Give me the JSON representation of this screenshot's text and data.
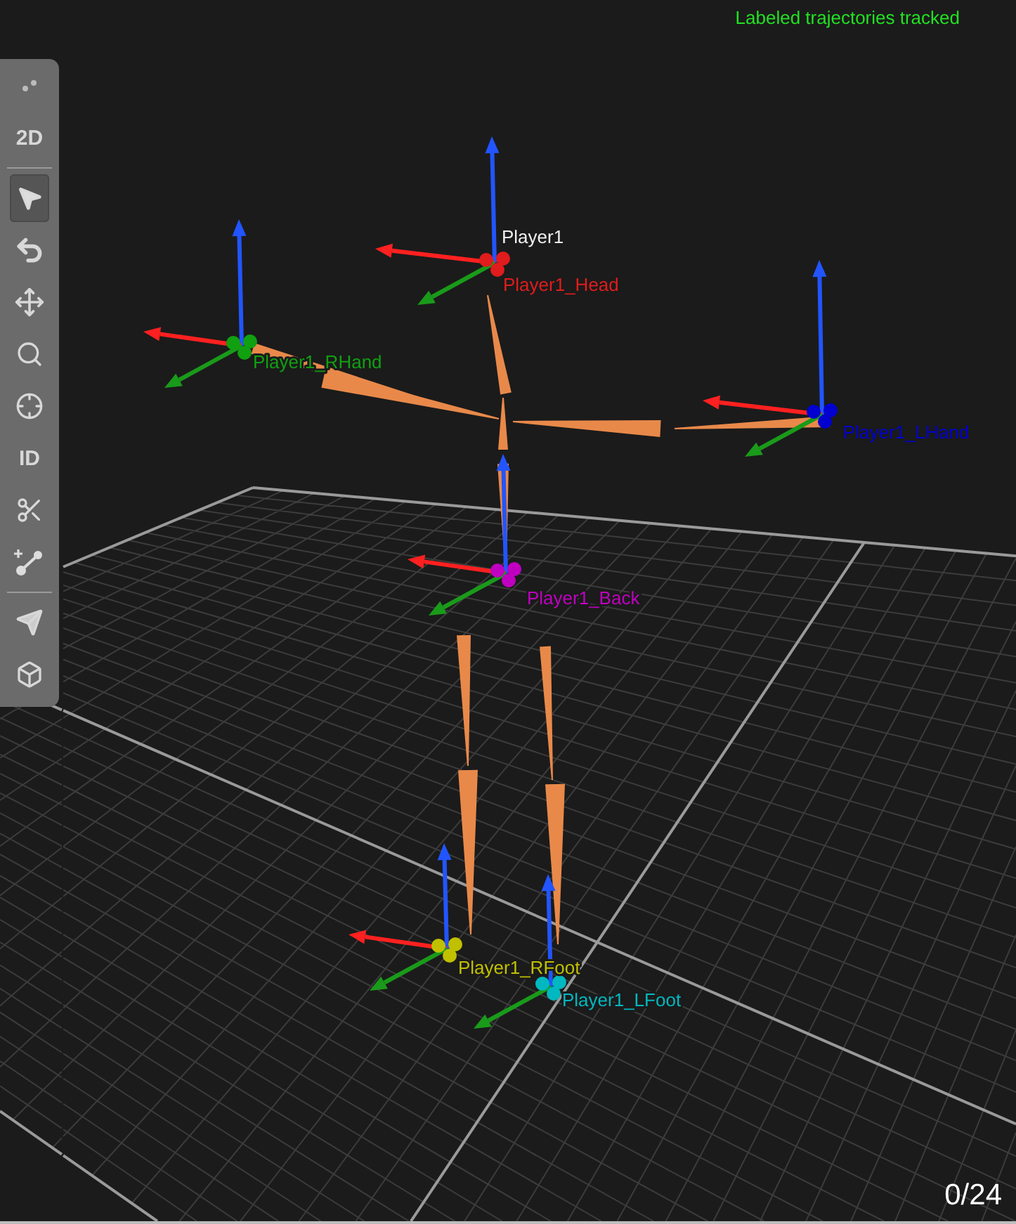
{
  "status": {
    "message": "Labeled trajectories tracked",
    "frame_counter": "0/24"
  },
  "toolbar": {
    "groups": [
      [
        {
          "kind": "icon",
          "selected": false
        },
        {
          "kind": "text",
          "label": "2D",
          "selected": false
        }
      ],
      [
        {
          "kind": "icon",
          "selected": true
        },
        {
          "kind": "icon",
          "selected": false
        },
        {
          "kind": "icon",
          "selected": false
        },
        {
          "kind": "icon",
          "selected": false
        },
        {
          "kind": "icon",
          "selected": false
        },
        {
          "kind": "text",
          "label": "ID",
          "selected": false
        },
        {
          "kind": "icon",
          "selected": false
        },
        {
          "kind": "icon",
          "selected": false
        }
      ],
      [
        {
          "kind": "icon",
          "selected": false
        },
        {
          "kind": "icon",
          "selected": false
        }
      ]
    ]
  },
  "skeleton": {
    "name": "Player1"
  },
  "markers": [
    {
      "label": "Player1_Head",
      "color": "#e01c1c"
    },
    {
      "label": "Player1_RHand",
      "color": "#10a010"
    },
    {
      "label": "Player1_LHand",
      "color": "#0000d0"
    },
    {
      "label": "Player1_Back",
      "color": "#c000c0"
    },
    {
      "label": "Player1_RFoot",
      "color": "#c0c000"
    },
    {
      "label": "Player1_LFoot",
      "color": "#00b8c0"
    }
  ]
}
